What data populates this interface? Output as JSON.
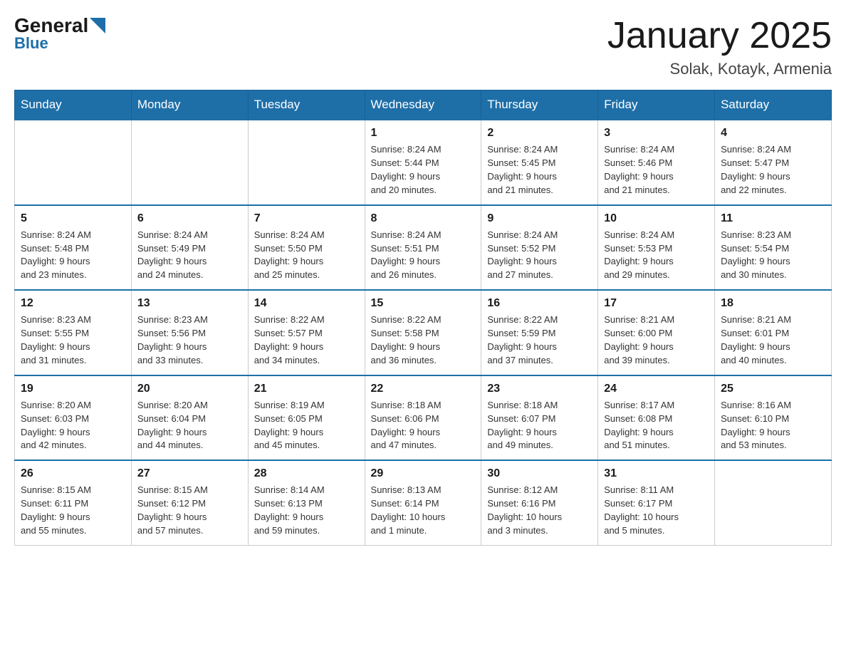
{
  "logo": {
    "general": "General",
    "blue": "Blue"
  },
  "header": {
    "title": "January 2025",
    "subtitle": "Solak, Kotayk, Armenia"
  },
  "days": {
    "headers": [
      "Sunday",
      "Monday",
      "Tuesday",
      "Wednesday",
      "Thursday",
      "Friday",
      "Saturday"
    ]
  },
  "weeks": [
    {
      "cells": [
        {
          "day": "",
          "info": ""
        },
        {
          "day": "",
          "info": ""
        },
        {
          "day": "",
          "info": ""
        },
        {
          "day": "1",
          "info": "Sunrise: 8:24 AM\nSunset: 5:44 PM\nDaylight: 9 hours\nand 20 minutes."
        },
        {
          "day": "2",
          "info": "Sunrise: 8:24 AM\nSunset: 5:45 PM\nDaylight: 9 hours\nand 21 minutes."
        },
        {
          "day": "3",
          "info": "Sunrise: 8:24 AM\nSunset: 5:46 PM\nDaylight: 9 hours\nand 21 minutes."
        },
        {
          "day": "4",
          "info": "Sunrise: 8:24 AM\nSunset: 5:47 PM\nDaylight: 9 hours\nand 22 minutes."
        }
      ]
    },
    {
      "cells": [
        {
          "day": "5",
          "info": "Sunrise: 8:24 AM\nSunset: 5:48 PM\nDaylight: 9 hours\nand 23 minutes."
        },
        {
          "day": "6",
          "info": "Sunrise: 8:24 AM\nSunset: 5:49 PM\nDaylight: 9 hours\nand 24 minutes."
        },
        {
          "day": "7",
          "info": "Sunrise: 8:24 AM\nSunset: 5:50 PM\nDaylight: 9 hours\nand 25 minutes."
        },
        {
          "day": "8",
          "info": "Sunrise: 8:24 AM\nSunset: 5:51 PM\nDaylight: 9 hours\nand 26 minutes."
        },
        {
          "day": "9",
          "info": "Sunrise: 8:24 AM\nSunset: 5:52 PM\nDaylight: 9 hours\nand 27 minutes."
        },
        {
          "day": "10",
          "info": "Sunrise: 8:24 AM\nSunset: 5:53 PM\nDaylight: 9 hours\nand 29 minutes."
        },
        {
          "day": "11",
          "info": "Sunrise: 8:23 AM\nSunset: 5:54 PM\nDaylight: 9 hours\nand 30 minutes."
        }
      ]
    },
    {
      "cells": [
        {
          "day": "12",
          "info": "Sunrise: 8:23 AM\nSunset: 5:55 PM\nDaylight: 9 hours\nand 31 minutes."
        },
        {
          "day": "13",
          "info": "Sunrise: 8:23 AM\nSunset: 5:56 PM\nDaylight: 9 hours\nand 33 minutes."
        },
        {
          "day": "14",
          "info": "Sunrise: 8:22 AM\nSunset: 5:57 PM\nDaylight: 9 hours\nand 34 minutes."
        },
        {
          "day": "15",
          "info": "Sunrise: 8:22 AM\nSunset: 5:58 PM\nDaylight: 9 hours\nand 36 minutes."
        },
        {
          "day": "16",
          "info": "Sunrise: 8:22 AM\nSunset: 5:59 PM\nDaylight: 9 hours\nand 37 minutes."
        },
        {
          "day": "17",
          "info": "Sunrise: 8:21 AM\nSunset: 6:00 PM\nDaylight: 9 hours\nand 39 minutes."
        },
        {
          "day": "18",
          "info": "Sunrise: 8:21 AM\nSunset: 6:01 PM\nDaylight: 9 hours\nand 40 minutes."
        }
      ]
    },
    {
      "cells": [
        {
          "day": "19",
          "info": "Sunrise: 8:20 AM\nSunset: 6:03 PM\nDaylight: 9 hours\nand 42 minutes."
        },
        {
          "day": "20",
          "info": "Sunrise: 8:20 AM\nSunset: 6:04 PM\nDaylight: 9 hours\nand 44 minutes."
        },
        {
          "day": "21",
          "info": "Sunrise: 8:19 AM\nSunset: 6:05 PM\nDaylight: 9 hours\nand 45 minutes."
        },
        {
          "day": "22",
          "info": "Sunrise: 8:18 AM\nSunset: 6:06 PM\nDaylight: 9 hours\nand 47 minutes."
        },
        {
          "day": "23",
          "info": "Sunrise: 8:18 AM\nSunset: 6:07 PM\nDaylight: 9 hours\nand 49 minutes."
        },
        {
          "day": "24",
          "info": "Sunrise: 8:17 AM\nSunset: 6:08 PM\nDaylight: 9 hours\nand 51 minutes."
        },
        {
          "day": "25",
          "info": "Sunrise: 8:16 AM\nSunset: 6:10 PM\nDaylight: 9 hours\nand 53 minutes."
        }
      ]
    },
    {
      "cells": [
        {
          "day": "26",
          "info": "Sunrise: 8:15 AM\nSunset: 6:11 PM\nDaylight: 9 hours\nand 55 minutes."
        },
        {
          "day": "27",
          "info": "Sunrise: 8:15 AM\nSunset: 6:12 PM\nDaylight: 9 hours\nand 57 minutes."
        },
        {
          "day": "28",
          "info": "Sunrise: 8:14 AM\nSunset: 6:13 PM\nDaylight: 9 hours\nand 59 minutes."
        },
        {
          "day": "29",
          "info": "Sunrise: 8:13 AM\nSunset: 6:14 PM\nDaylight: 10 hours\nand 1 minute."
        },
        {
          "day": "30",
          "info": "Sunrise: 8:12 AM\nSunset: 6:16 PM\nDaylight: 10 hours\nand 3 minutes."
        },
        {
          "day": "31",
          "info": "Sunrise: 8:11 AM\nSunset: 6:17 PM\nDaylight: 10 hours\nand 5 minutes."
        },
        {
          "day": "",
          "info": ""
        }
      ]
    }
  ]
}
